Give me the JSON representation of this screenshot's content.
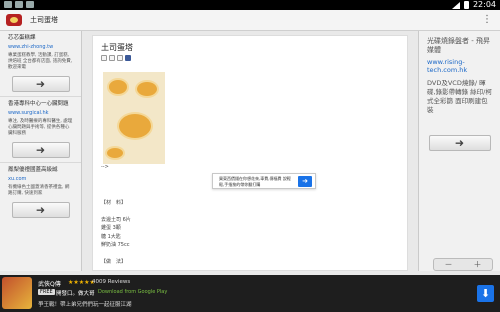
{
  "status_bar": {
    "time": "22:04"
  },
  "app_bar": {
    "title": "土司蛋塔",
    "menu_icon": "overflow-menu-icon"
  },
  "left_sidebar": {
    "blocks": [
      {
        "title": "芯芯蛋糕課",
        "url": "www.zhi-zhong.tw",
        "desc": "專業蛋糕教學, 活動課, 訂蛋糕, 烘焙班 全台都有店面, 諮詢免費, 歡迎來電"
      },
      {
        "title": "香港專科中心一心臟問題",
        "url": "www.surgical.hk",
        "desc": "專注, 及時醫療的專科醫生, 處理心臟問題與手術等, 提供各種心臟科服務"
      },
      {
        "title": "鳳梨優禮國蓋高級誠",
        "url": "xu.com",
        "desc": "有機綠色土國蓋清香茶禮盒, 網路訂購, 快速到家"
      }
    ],
    "button_icon": "arrow-right-icon"
  },
  "article": {
    "title": "土司蛋塔",
    "arrow_text": "-->",
    "ad": {
      "text": "買東西價錢在你想花來,車費,傳福費 說輕鬆,手指按的帶你翻打購",
      "button_icon": "arrow-right-icon"
    },
    "ingredients_header": "【材　料】",
    "ingredients": [
      "去邊土司 6片",
      "雞蛋 3顆",
      "糖 1大匙",
      "鮮奶油 75cc"
    ],
    "method_header": "【做　法】"
  },
  "right_sidebar": {
    "title": "光碟燒錄盤者 - 飛昇媒體",
    "url": "www.rising-tech.com.hk",
    "desc": "DVD及VCD燒錄/ 暉碟,錄影帶轉錄 絲印/柯式全彩篩 面印刷建包裝"
  },
  "zoom": {
    "out": "－",
    "in": "＋"
  },
  "banner": {
    "title": "武俠Q傳",
    "stars": "★★★★★",
    "reviews": "4009 Reviews",
    "free_badge": "FREE",
    "line2": "開發口。做大哥",
    "store": "Download from Google Play",
    "desc": "爭王戰！帶上弟兄們們玩一起征服江湖",
    "download_icon": "download-arrow-icon"
  },
  "colors": {
    "accent": "#1a73e8",
    "link": "#1a67c7",
    "banner_bg": "#1e1e1e"
  }
}
